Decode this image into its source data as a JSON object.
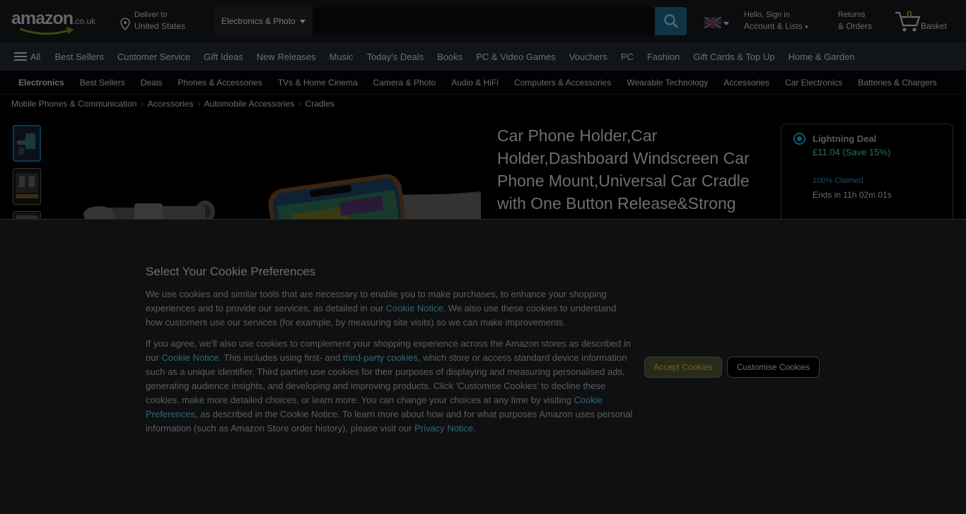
{
  "header": {
    "logo_word": "amazon",
    "logo_tld": ".co.uk",
    "deliver_line1": "Deliver to",
    "deliver_line2": "United States",
    "search": {
      "category": "Electronics & Photo",
      "value": "",
      "placeholder": ""
    },
    "account_line1": "Hello, Sign in",
    "account_line2": "Account & Lists",
    "returns_line1": "Returns",
    "returns_line2": "& Orders",
    "basket_count": "0",
    "basket_label": "Basket"
  },
  "nav": {
    "all_label": "All",
    "items": [
      "Best Sellers",
      "Customer Service",
      "Gift Ideas",
      "New Releases",
      "Music",
      "Today's Deals",
      "Books",
      "PC & Video Games",
      "Vouchers",
      "PC",
      "Fashion",
      "Gift Cards & Top Up",
      "Home & Garden"
    ]
  },
  "subnav": {
    "items": [
      "Electronics",
      "Best Sellers",
      "Deals",
      "Phones & Accessories",
      "TVs & Home Cinema",
      "Camera & Photo",
      "Audio & HiFi",
      "Computers & Accessories",
      "Wearable Technology",
      "Accessories",
      "Car Electronics",
      "Batteries & Chargers"
    ]
  },
  "breadcrumb": [
    "Mobile Phones & Communication",
    "Accessories",
    "Automobile Accessories",
    "Cradles"
  ],
  "product": {
    "title": "Car Phone Holder,Car Holder,Dashboard Windscreen Car Phone Mount,Universal Car Cradle with One Button Release&Strong"
  },
  "buybox": {
    "deal_label": "Lightning Deal",
    "price": "£11.04 (Save 15%)",
    "claimed": "100% Claimed",
    "ends": "Ends in 11h 02m 01s"
  },
  "cookie": {
    "title": "Select Your Cookie Preferences",
    "p1_a": "We use cookies and similar tools that are necessary to enable you to make purchases, to enhance your shopping experiences and to provide our services, as detailed in our ",
    "p1_link": "Cookie Notice",
    "p1_b": ". We also use these cookies to understand how customers use our services (for example, by measuring site visits) so we can make improvements.",
    "p2_a": "If you agree, we'll also use cookies to complement your shopping experience across the Amazon stores as described in our ",
    "p2_link1": "Cookie Notice",
    "p2_b": ". This includes using first- and ",
    "p2_link2": "third-party cookies",
    "p2_c": ", which store or access standard device information such as a unique identifier. Third parties use cookies for their purposes of displaying and measuring personalised ads, generating audience insights, and developing and improving products. Click 'Customise Cookies' to decline these cookies, make more detailed choices, or learn more. You can change your choices at any time by visiting ",
    "p2_link3": "Cookie Preferences",
    "p2_d": ", as described in the Cookie Notice. To learn more about how and for what purposes Amazon uses personal information (such as Amazon Store order history), please visit our ",
    "p2_link4": "Privacy Notice",
    "p2_e": ".",
    "accept_label": "Accept Cookies",
    "customise_label": "Customise Cookies"
  },
  "colors": {
    "overlay_bg": "#0f1011",
    "link": "#2f6876",
    "accept_bg": "#2a2a1a"
  }
}
